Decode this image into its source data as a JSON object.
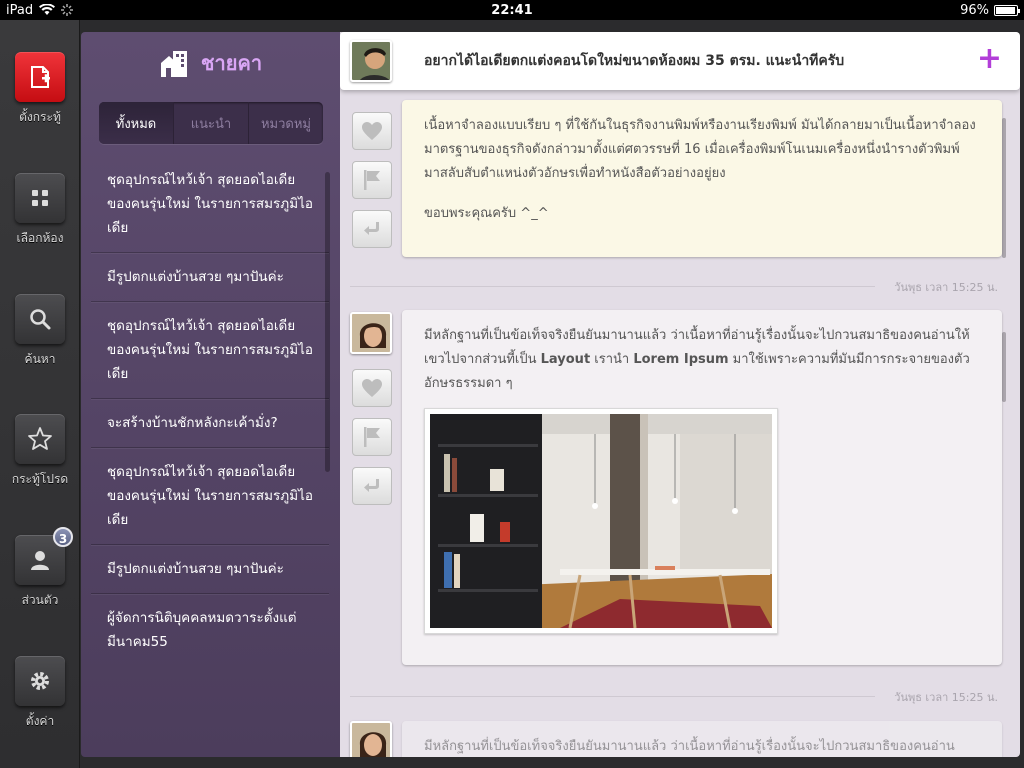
{
  "status_bar": {
    "device": "iPad",
    "time": "22:41",
    "battery": "96%",
    "battery_level": 0.96
  },
  "rail": {
    "items": [
      {
        "label": "ตั้งกระทู้",
        "icon": "new-post-icon"
      },
      {
        "label": "เลือกห้อง",
        "icon": "grid-icon"
      },
      {
        "label": "ค้นหา",
        "icon": "search-icon"
      },
      {
        "label": "กระทู้โปรด",
        "icon": "star-icon"
      },
      {
        "label": "ส่วนตัว",
        "icon": "user-icon",
        "badge": "3"
      },
      {
        "label": "ตั้งค่า",
        "icon": "gear-icon"
      }
    ]
  },
  "sidebar": {
    "title": "ชายคา",
    "tabs": [
      "ทั้งหมด",
      "แนะนำ",
      "หมวดหมู่"
    ],
    "active_tab": 0,
    "topics": [
      "ชุดอุปกรณ์ไหว้เจ้า สุดยอดไอเดียของคนรุ่นใหม่ ในรายการสมรภูมิไอเดีย",
      "มีรูปตกแต่งบ้านสวย ๆมาปันค่ะ",
      "ชุดอุปกรณ์ไหว้เจ้า สุดยอดไอเดียของคนรุ่นใหม่ ในรายการสมรภูมิไอเดีย",
      "จะสร้างบ้านชักหลังกะเค้ามั่ง?",
      "ชุดอุปกรณ์ไหว้เจ้า สุดยอดไอเดียของคนรุ่นใหม่ ในรายการสมรภูมิไอเดีย",
      "มีรูปตกแต่งบ้านสวย ๆมาปันค่ะ",
      "ผู้จัดการนิติบุคคลหมดวาระตั้งแต่มีนาคม55"
    ]
  },
  "thread": {
    "question": "อยากได้ไอเดียตกแต่งคอนโดใหม่ขนาดห้องผม 35 ตรม. แนะนำทีครับ",
    "posts": [
      {
        "body": "เนื้อหาจำลองแบบเรียบ ๆ ที่ใช้กันในธุรกิจงานพิมพ์หรืองานเรียงพิมพ์ มันได้กลายมาเป็นเนื้อหาจำลองมาตรฐานของธุรกิจดังกล่าวมาตั้งแต่ศตวรรษที่ 16 เมื่อเครื่องพิมพ์โนเนมเครื่องหนึ่งนำรางตัวพิมพ์มาสลับสับตำแหน่งตัวอักษรเพื่อทำหนังสือตัวอย่างอยู่ยง",
        "signoff": "ขอบพระคุณครับ ^_^",
        "time": "วันพุธ เวลา 15:25 น."
      },
      {
        "body_start": "มีหลักฐานที่เป็นข้อเท็จจริงยืนยันมานานแล้ว ว่าเนื้อหาที่อ่านรู้เรื่องนั้นจะไปกวนสมาธิของคนอ่านให้เขวไปจากส่วนที้เป็น ",
        "body_bold1": "Layout",
        "body_mid": " เรานำ ",
        "body_bold2": "Lorem Ipsum",
        "body_end": " มาใช้เพราะความที่มันมีการกระจายของตัวอักษรธรรมดา ๆ",
        "time": "วันพุธ เวลา 15:25 น."
      },
      {
        "body": "มีหลักฐานที่เป็นข้อเท็จจริงยืนยันมานานแล้ว ว่าเนื้อหาที่อ่านรู้เรื่องนั้นจะไปกวนสมาธิของคนอ่าน"
      }
    ],
    "action_icons": [
      "heart-icon",
      "flag-icon",
      "reply-icon"
    ]
  },
  "colors": {
    "accent": "#b23ed8",
    "sidebar": "#5e4d70",
    "red_button": "#e0242a"
  }
}
